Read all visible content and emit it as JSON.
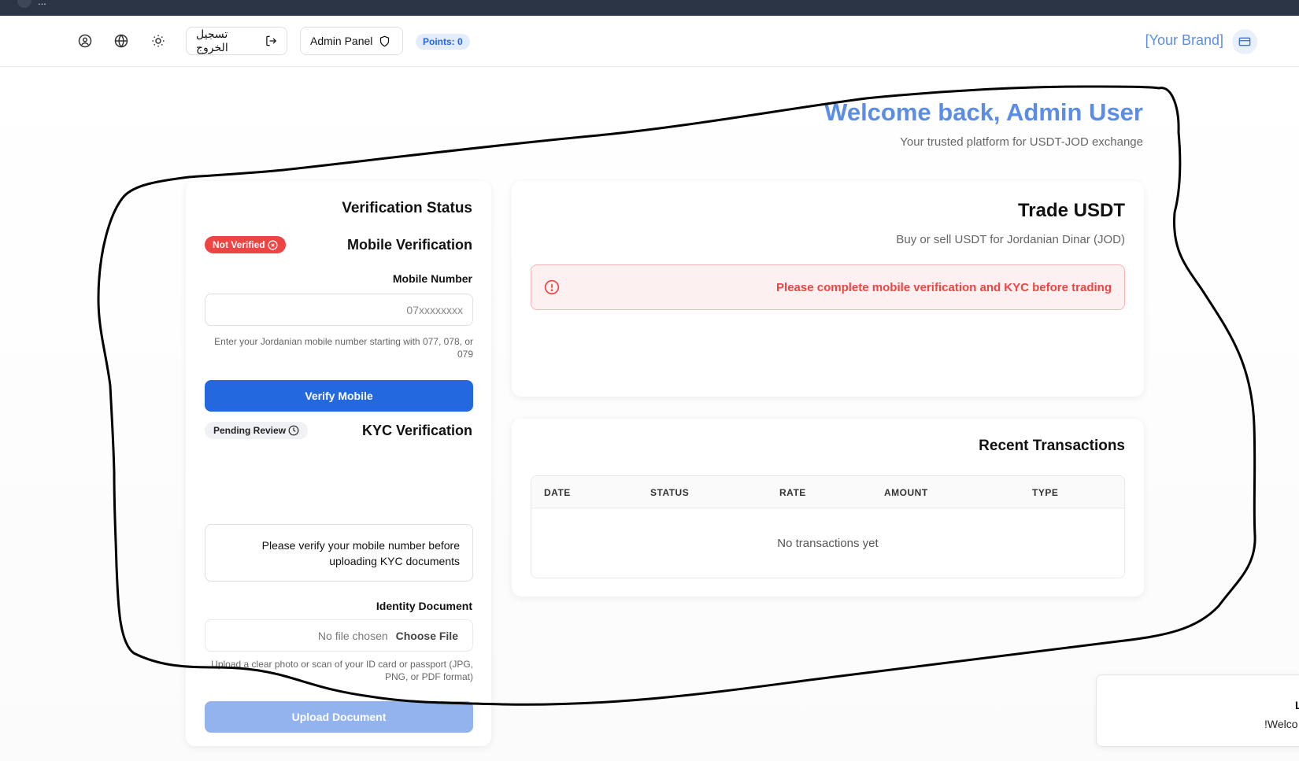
{
  "browser": {
    "url_fragment": "..."
  },
  "navbar": {
    "logout_label": "تسجيل الخروج",
    "admin_panel_label": "Admin Panel",
    "points_label": "Points: 0",
    "brand": "[Your Brand]"
  },
  "hero": {
    "welcome": "Welcome back, Admin User",
    "tagline": "Your trusted platform for USDT-JOD exchange"
  },
  "verification": {
    "title": "Verification Status",
    "mobile": {
      "heading": "Mobile Verification",
      "status": "Not Verified",
      "field_label": "Mobile Number",
      "placeholder": "07xxxxxxxx",
      "hint": "Enter your Jordanian mobile number starting with 077, 078, or 079",
      "button": "Verify Mobile"
    },
    "kyc": {
      "heading": "KYC Verification",
      "status": "Pending Review",
      "notice": "Please verify your mobile number before uploading KYC documents",
      "field_label": "Identity Document",
      "no_file": "No file chosen",
      "choose_file": "Choose File",
      "hint": "Upload a clear photo or scan of your ID card or passport (JPG, PNG, or PDF format)",
      "button": "Upload Document"
    }
  },
  "trade": {
    "title": "Trade USDT",
    "subtitle": "Buy or sell USDT for Jordanian Dinar (JOD)",
    "alert": "Please complete mobile verification and KYC before trading"
  },
  "transactions": {
    "title": "Recent Transactions",
    "columns": [
      "DATE",
      "STATUS",
      "RATE",
      "AMOUNT",
      "TYPE"
    ],
    "empty": "No transactions yet"
  },
  "toast": {
    "line1": "L",
    "line2": "!Welco"
  },
  "colors": {
    "primary": "#2468e0",
    "brand": "#5b8de6",
    "danger": "#ef4444",
    "topbar": "#2b3445"
  }
}
